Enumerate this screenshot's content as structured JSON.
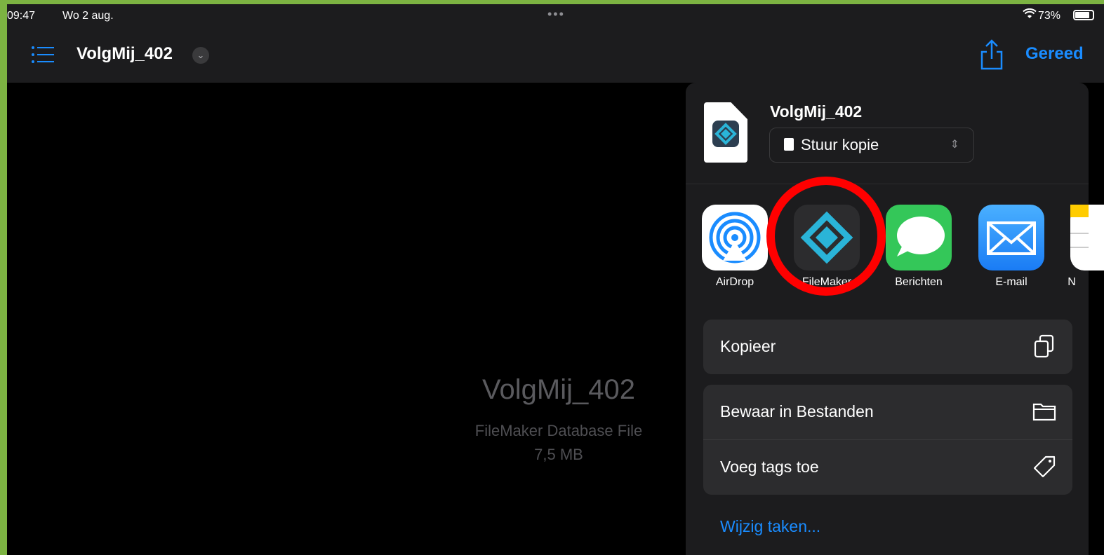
{
  "status": {
    "time": "09:47",
    "date": "Wo 2 aug.",
    "battery": "73%"
  },
  "nav": {
    "title": "VolgMij_402",
    "done_label": "Gereed"
  },
  "file": {
    "name": "VolgMij_402",
    "type": "FileMaker Database File",
    "size": "7,5 MB"
  },
  "share_sheet": {
    "filename": "VolgMij_402",
    "mode": "Stuur kopie",
    "apps": [
      {
        "label": "AirDrop",
        "icon": "airdrop-icon"
      },
      {
        "label": "FileMaker",
        "icon": "filemaker-icon"
      },
      {
        "label": "Berichten",
        "icon": "messages-icon"
      },
      {
        "label": "E-mail",
        "icon": "mail-icon"
      },
      {
        "label": "N",
        "icon": "notes-icon"
      }
    ],
    "actions": [
      {
        "label": "Kopieer",
        "icon": "copy-icon"
      },
      {
        "label": "Bewaar in Bestanden",
        "icon": "folder-icon"
      },
      {
        "label": "Voeg tags toe",
        "icon": "tag-icon"
      }
    ],
    "edit_actions": "Wijzig taken..."
  },
  "colors": {
    "accent": "#1a8cff",
    "highlight": "#ff0000",
    "frame": "#7cb342"
  }
}
